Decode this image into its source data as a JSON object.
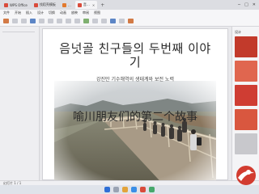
{
  "tabs": [
    {
      "label": "WPS Office",
      "color": "#d94b3b"
    },
    {
      "label": "找稻壳模板",
      "color": "#d94b3b"
    },
    {
      "label": "…",
      "color": "#e27a2f"
    },
    {
      "label": "音…",
      "color": "#d94b3b"
    }
  ],
  "ribbon_menu": [
    "文件",
    "开始",
    "插入",
    "设计",
    "切换",
    "动画",
    "放映",
    "审阅",
    "视图"
  ],
  "slide": {
    "title_line1": "음넛골 친구들의 두번째 이야",
    "title_line2": "기",
    "subtitle": "강진만 기수해역의 생태계와 보전 노력",
    "chinese_title": "喻川朋友们的第二个故事"
  },
  "right_panel": {
    "title": "设计",
    "cards": [
      "#c23a2b",
      "#e0664f",
      "#cf3d33",
      "#d9573f"
    ]
  },
  "status": {
    "text": "幻灯片 1 / 1"
  },
  "colors": {
    "accent": "#d94b3b"
  }
}
